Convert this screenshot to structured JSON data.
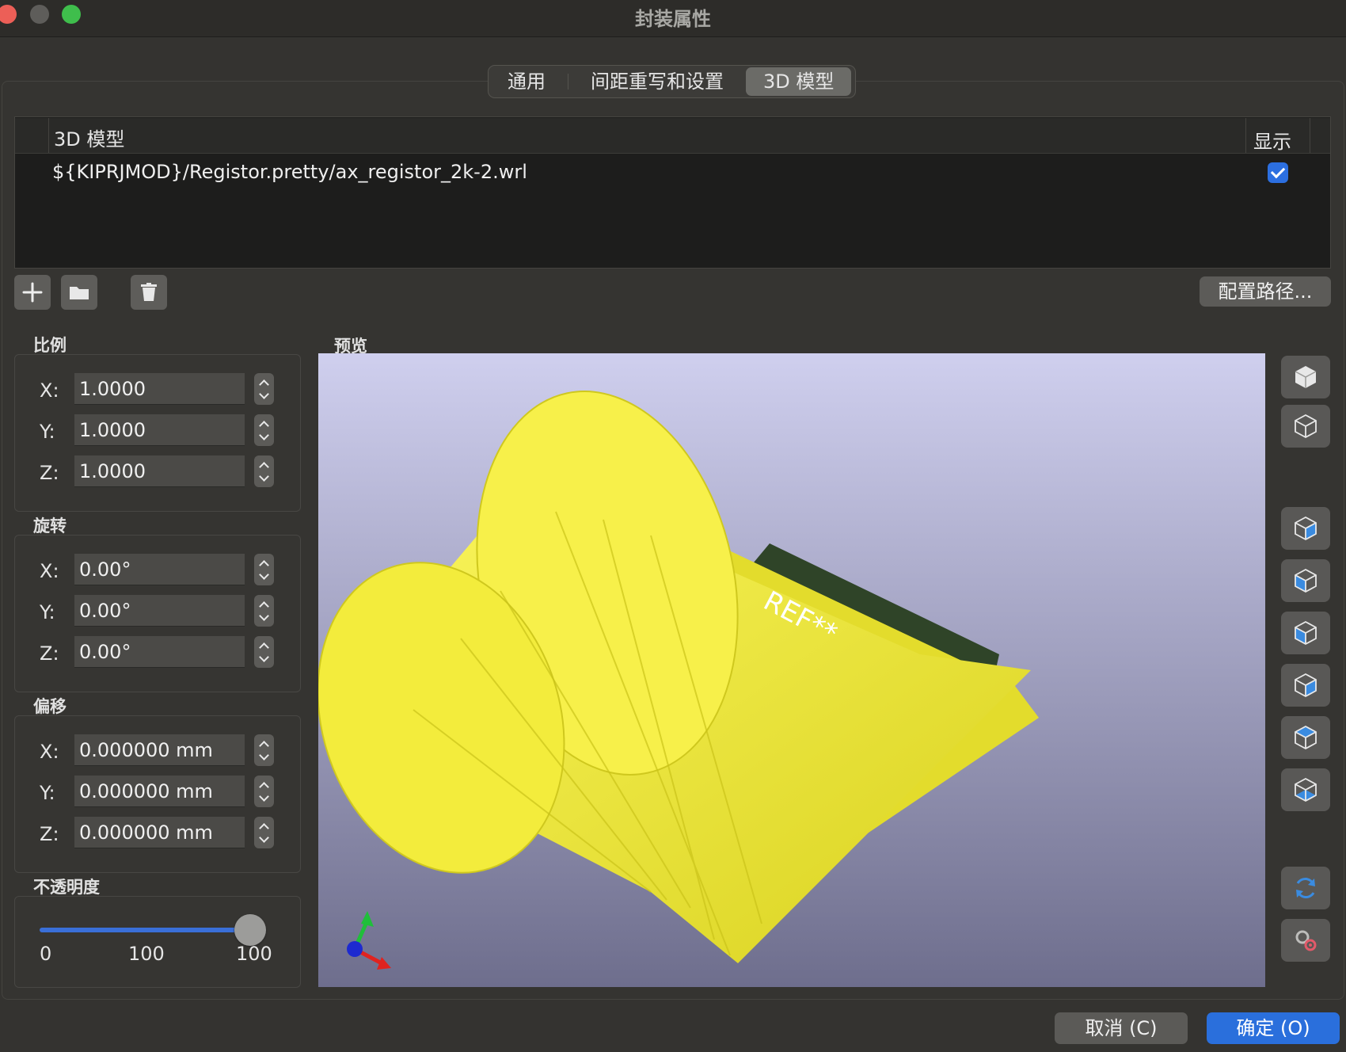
{
  "window": {
    "title": "封装属性"
  },
  "tabs": [
    {
      "label": "通用",
      "active": false
    },
    {
      "label": "间距重写和设置",
      "active": false
    },
    {
      "label": "3D 模型",
      "active": true
    }
  ],
  "model_table": {
    "columns": {
      "model": "3D 模型",
      "show": "显示"
    },
    "rows": [
      {
        "path": "${KIPRJMOD}/Registor.pretty/ax_registor_2k-2.wrl",
        "show": true
      }
    ]
  },
  "toolbar": {
    "add_icon": "plus-icon",
    "browse_icon": "folder-icon",
    "delete_icon": "trash-icon",
    "config_paths_label": "配置路径..."
  },
  "scale": {
    "title": "比例",
    "x_label": "X:",
    "x": "1.0000",
    "y_label": "Y:",
    "y": "1.0000",
    "z_label": "Z:",
    "z": "1.0000"
  },
  "rotation": {
    "title": "旋转",
    "x_label": "X:",
    "x": "0.00°",
    "y_label": "Y:",
    "y": "0.00°",
    "z_label": "Z:",
    "z": "0.00°"
  },
  "offset": {
    "title": "偏移",
    "x_label": "X:",
    "x": "0.000000 mm",
    "y_label": "Y:",
    "y": "0.000000 mm",
    "z_label": "Z:",
    "z": "0.000000 mm"
  },
  "opacity": {
    "title": "不透明度",
    "min_label": "0",
    "mid_label": "100",
    "value_label": "100",
    "value": 1.0
  },
  "preview": {
    "title": "预览",
    "ref_text": "REF**",
    "model_color": "#f5ee3d",
    "view_buttons": [
      "cube-solid-icon",
      "cube-wire-icon",
      "view-left-icon",
      "view-right-icon",
      "view-front-icon",
      "view-back-icon",
      "view-top-icon",
      "view-bottom-icon",
      "reload-icon",
      "settings-icon"
    ]
  },
  "footer": {
    "cancel_label": "取消 (C)",
    "ok_label": "确定 (O)"
  },
  "colors": {
    "accent": "#2a6fdc",
    "traffic_red": "#ec5f57",
    "traffic_gray": "#5e5d5a",
    "traffic_green": "#3fbe4c"
  }
}
